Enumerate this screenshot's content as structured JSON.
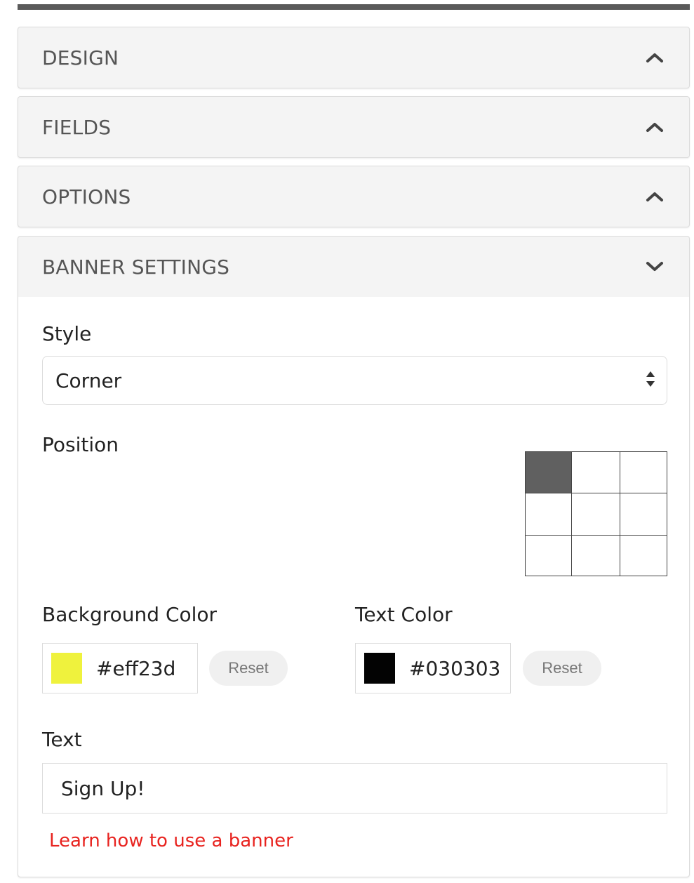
{
  "colors": {
    "accent_link": "#e8231f",
    "position_active": "#606060"
  },
  "panels": {
    "design": {
      "title": "DESIGN",
      "icon": "chevron-up-icon"
    },
    "fields": {
      "title": "FIELDS",
      "icon": "chevron-up-icon"
    },
    "options": {
      "title": "OPTIONS",
      "icon": "chevron-up-icon"
    },
    "banner": {
      "title": "BANNER SETTINGS",
      "icon": "chevron-down-icon"
    }
  },
  "banner": {
    "style_label": "Style",
    "style_value": "Corner",
    "position_label": "Position",
    "position_selected": "top-left",
    "background_color_label": "Background Color",
    "background_color_value": "#eff23d",
    "text_color_label": "Text Color",
    "text_color_value": "#030303",
    "reset_label": "Reset",
    "text_label": "Text",
    "text_value": "Sign Up!",
    "learn_link": "Learn how to use a banner"
  }
}
